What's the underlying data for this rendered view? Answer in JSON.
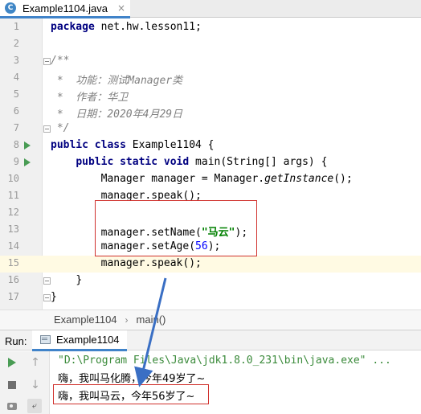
{
  "tab": {
    "icon": "java-class-icon",
    "label": "Example1104.java",
    "close": "×"
  },
  "editor": {
    "lines": [
      {
        "n": "1"
      },
      {
        "n": "2"
      },
      {
        "n": "3"
      },
      {
        "n": "4"
      },
      {
        "n": "5"
      },
      {
        "n": "6"
      },
      {
        "n": "7"
      },
      {
        "n": "8"
      },
      {
        "n": "9"
      },
      {
        "n": "10"
      },
      {
        "n": "11"
      },
      {
        "n": "12"
      },
      {
        "n": "13"
      },
      {
        "n": "14"
      },
      {
        "n": "15"
      },
      {
        "n": "16"
      },
      {
        "n": "17"
      }
    ],
    "code": {
      "l1_kw": "package",
      "l1_rest": " net.hw.lesson11;",
      "l3": "/**",
      "l4": " *  功能：测试Manager类",
      "l5": " *  作者：华卫",
      "l6": " *  日期：2020年4月29日",
      "l7": " */",
      "l8_kw1": "public",
      "l8_kw2": "class",
      "l8_rest": " Example1104 {",
      "l9_kw1": "public",
      "l9_kw2": "static",
      "l9_kw3": "void",
      "l9_rest": " main(String[] args) {",
      "l10_a": "Manager manager = Manager.",
      "l10_it": "getInstance",
      "l10_b": "();",
      "l11": "manager.speak();",
      "l13_a": "manager.setName(",
      "l13_str": "\"马云\"",
      "l13_b": ");",
      "l14_a": "manager.setAge(",
      "l14_num": "56",
      "l14_b": ");",
      "l15": "manager.speak();",
      "l16": "}",
      "l17": "}"
    }
  },
  "breadcrumb": {
    "class": "Example1104",
    "sep": "›",
    "method": "main()"
  },
  "run": {
    "title": "Run:",
    "tab_label": "Example1104",
    "output": [
      "\"D:\\Program Files\\Java\\jdk1.8.0_231\\bin\\java.exe\" ...",
      "嗨，我叫马化腾，今年49岁了~",
      "嗨，我叫马云，今年56岁了~"
    ]
  },
  "colors": {
    "annotation": "#d0312d",
    "arrow": "#3a6fc4",
    "tab_underline": "#4083c9"
  }
}
